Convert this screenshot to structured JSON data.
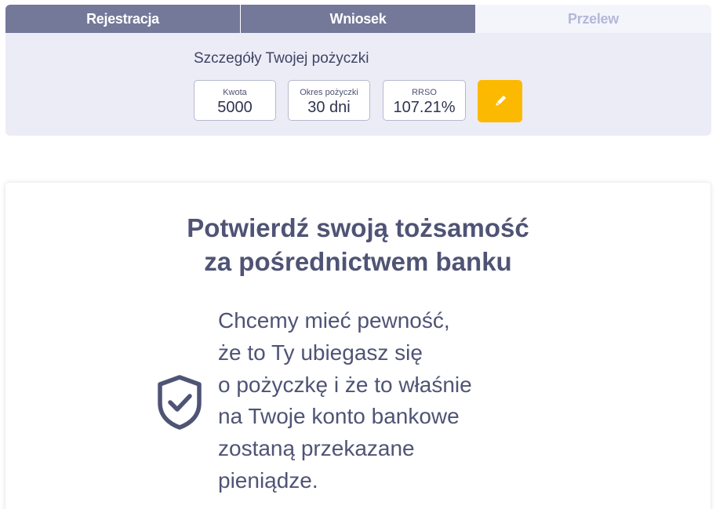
{
  "steps": [
    {
      "label": "Rejestracja",
      "state": "done"
    },
    {
      "label": "Wniosek",
      "state": "active"
    },
    {
      "label": "Przelew",
      "state": "pending"
    }
  ],
  "loan_details": {
    "title": "Szczegóły Twojej pożyczki",
    "amount": {
      "label": "Kwota",
      "value": "5000"
    },
    "period": {
      "label": "Okres pożyczki",
      "value": "30 dni"
    },
    "rrso": {
      "label": "RRSO",
      "value": "107.21%"
    },
    "edit_icon": "pencil-icon"
  },
  "identity": {
    "heading_lines": [
      "Potwierdź swoją tożsamość",
      "za pośrednictwem banku"
    ],
    "message_lines": [
      "Chcemy mieć pewność,",
      "że to Ty ubiegasz się",
      "o pożyczkę i że to właśnie",
      "na Twoje konto bankowe",
      "zostaną przekazane",
      "pieniądze."
    ],
    "icon": "shield-check-icon"
  },
  "colors": {
    "step_active": "#747899",
    "step_pending_text": "#b4b8d8",
    "panel_bg": "#ececf7",
    "accent": "#fbb901",
    "text_primary": "#4f5475"
  }
}
